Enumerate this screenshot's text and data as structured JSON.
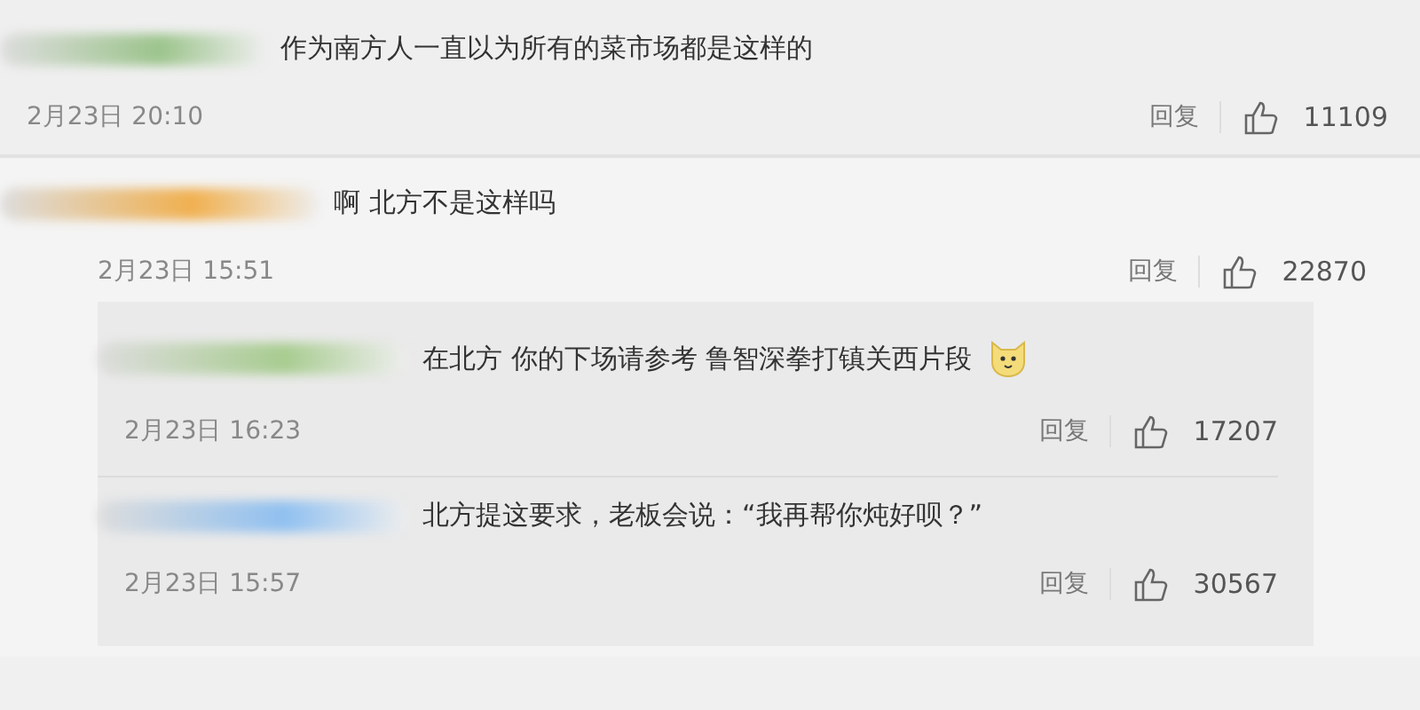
{
  "comments": [
    {
      "color": "#9cc48c",
      "text": "作为南方人一直以为所有的菜市场都是这样的",
      "time": "2月23日 20:10",
      "reply": "回复",
      "likes": "11109"
    },
    {
      "color": "#f0b050",
      "text": "啊 北方不是这样吗",
      "time": "2月23日 15:51",
      "reply": "回复",
      "likes": "22870",
      "children": [
        {
          "color": "#a8cc90",
          "text": "在北方 你的下场请参考 鲁智深拳打镇关西片段",
          "emoji": true,
          "time": "2月23日 16:23",
          "reply": "回复",
          "likes": "17207"
        },
        {
          "color": "#90c0f0",
          "text": "北方提这要求，老板会说：“我再帮你炖好呗？”",
          "emoji": false,
          "time": "2月23日 15:57",
          "reply": "回复",
          "likes": "30567"
        }
      ]
    }
  ]
}
